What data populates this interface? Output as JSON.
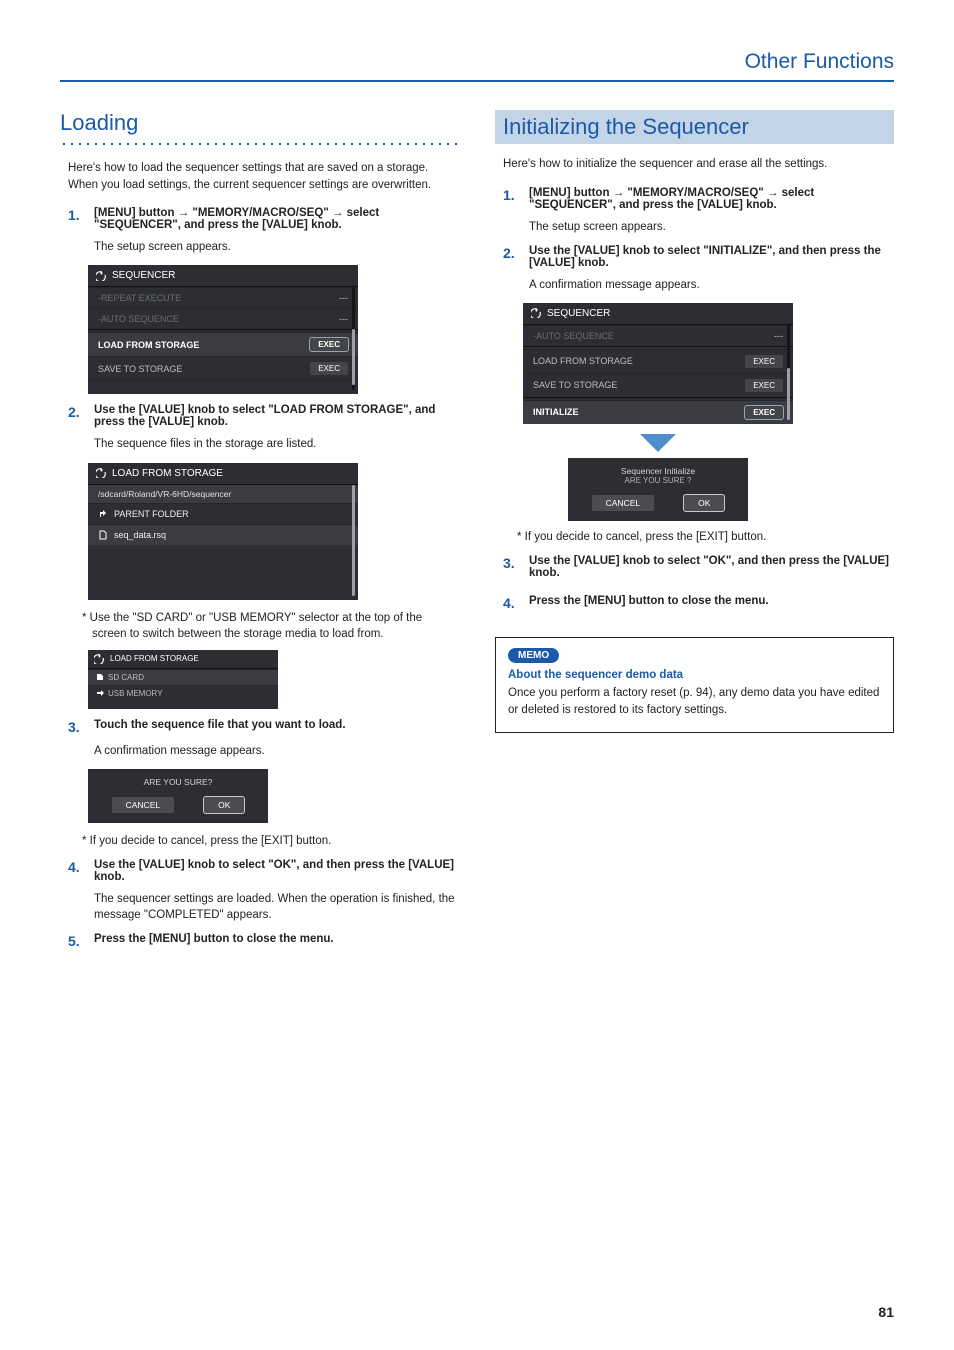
{
  "header": {
    "title": "Other Functions"
  },
  "pageNumber": "81",
  "loading": {
    "title": "Loading",
    "intro": "Here's how to load the sequencer settings that are saved on a storage. When you load settings, the current sequencer settings are overwritten.",
    "steps": {
      "s1": {
        "num": "1.",
        "parts": {
          "a": "[MENU] button",
          "b": "\"MEMORY/MACRO/SEQ\"",
          "c": "select \"SEQUENCER\", and press the [VALUE] knob."
        },
        "sub": "The setup screen appears."
      },
      "s2": {
        "num": "2.",
        "text": "Use the [VALUE] knob to select \"LOAD FROM STORAGE\", and press the [VALUE] knob.",
        "sub": "The sequence files in the storage are listed."
      },
      "s2note": "* Use the \"SD CARD\" or \"USB MEMORY\" selector at the top of the screen to switch between the storage media to load from.",
      "s3": {
        "num": "3.",
        "text": "Touch the sequence file that you want to load.",
        "sub": "A confirmation message appears."
      },
      "s3note": "* If you decide to cancel, press the [EXIT] button.",
      "s4": {
        "num": "4.",
        "text": "Use the [VALUE] knob to select \"OK\", and then press the [VALUE] knob.",
        "sub": "The sequencer settings are loaded. When the operation is finished, the message \"COMPLETED\" appears."
      },
      "s5": {
        "num": "5.",
        "text": "Press the [MENU] button to close the menu."
      }
    },
    "ss1": {
      "title": "SEQUENCER",
      "rows": [
        {
          "label": "-REPEAT EXECUTE",
          "val": "---"
        },
        {
          "label": "-AUTO SEQUENCE",
          "val": "---"
        },
        {
          "label": "LOAD FROM STORAGE",
          "val": "EXEC",
          "highlight": true
        },
        {
          "label": "SAVE TO STORAGE",
          "val": "EXEC"
        }
      ]
    },
    "ss2": {
      "title": "LOAD FROM STORAGE",
      "path": "/sdcard/Roland/VR-6HD/sequencer",
      "parent": "PARENT FOLDER",
      "file": "seq_data.rsq"
    },
    "ss3": {
      "title": "LOAD FROM STORAGE",
      "opts": [
        "SD CARD",
        "USB MEMORY"
      ]
    },
    "confirm": {
      "q": "ARE YOU SURE?",
      "cancel": "CANCEL",
      "ok": "OK"
    }
  },
  "init": {
    "title": "Initializing the Sequencer",
    "intro": "Here's how to initialize the sequencer and erase all the settings.",
    "steps": {
      "s1": {
        "num": "1.",
        "parts": {
          "a": "[MENU] button",
          "b": "\"MEMORY/MACRO/SEQ\"",
          "c": "select \"SEQUENCER\", and press the [VALUE] knob."
        },
        "sub": "The setup screen appears."
      },
      "s2": {
        "num": "2.",
        "text": "Use the [VALUE] knob to select \"INITIALIZE\", and then press the [VALUE] knob.",
        "sub": "A confirmation message appears."
      },
      "s2note": "* If you decide to cancel, press the [EXIT] button.",
      "s3": {
        "num": "3.",
        "text": "Use the [VALUE] knob to select \"OK\", and then press the [VALUE] knob."
      },
      "s4": {
        "num": "4.",
        "text": "Press the [MENU] button to close the menu."
      }
    },
    "ss": {
      "title": "SEQUENCER",
      "rows": [
        {
          "label": "-AUTO SEQUENCE",
          "val": "---"
        },
        {
          "label": "LOAD FROM STORAGE",
          "val": "EXEC"
        },
        {
          "label": "SAVE TO STORAGE",
          "val": "EXEC"
        },
        {
          "label": "INITIALIZE",
          "val": "EXEC",
          "highlight": true
        }
      ]
    },
    "confirm": {
      "ttl": "Sequencer Initialize",
      "q": "ARE YOU SURE ?",
      "cancel": "CANCEL",
      "ok": "OK"
    },
    "memo": {
      "badge": "MEMO",
      "title": "About the sequencer demo data",
      "body": "Once you perform a factory reset (p. 94), any demo data you have edited or deleted is restored to its factory settings."
    }
  }
}
